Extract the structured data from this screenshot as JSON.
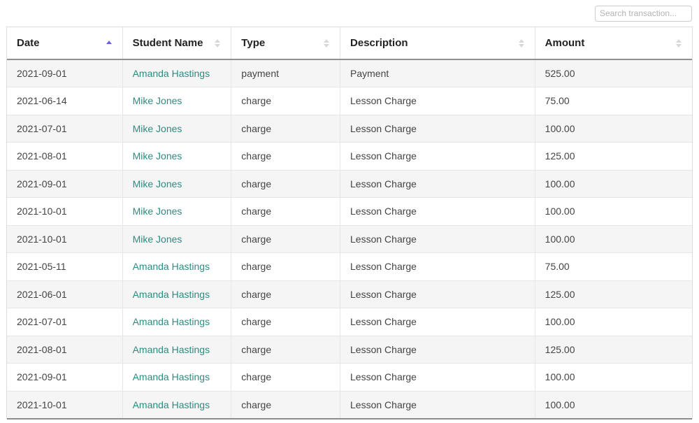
{
  "search": {
    "placeholder": "Search transaction...",
    "value": ""
  },
  "table": {
    "columns": [
      {
        "label": "Date",
        "sort": "asc",
        "key": "date"
      },
      {
        "label": "Student Name",
        "sort": "none",
        "key": "student_name"
      },
      {
        "label": "Type",
        "sort": "none",
        "key": "type"
      },
      {
        "label": "Description",
        "sort": "none",
        "key": "description"
      },
      {
        "label": "Amount",
        "sort": "none",
        "key": "amount"
      }
    ],
    "rows": [
      {
        "date": "2021-09-01",
        "student_name": "Amanda Hastings",
        "type": "payment",
        "description": "Payment",
        "amount": "525.00"
      },
      {
        "date": "2021-06-14",
        "student_name": "Mike Jones",
        "type": "charge",
        "description": "Lesson Charge",
        "amount": "75.00"
      },
      {
        "date": "2021-07-01",
        "student_name": "Mike Jones",
        "type": "charge",
        "description": "Lesson Charge",
        "amount": "100.00"
      },
      {
        "date": "2021-08-01",
        "student_name": "Mike Jones",
        "type": "charge",
        "description": "Lesson Charge",
        "amount": "125.00"
      },
      {
        "date": "2021-09-01",
        "student_name": "Mike Jones",
        "type": "charge",
        "description": "Lesson Charge",
        "amount": "100.00"
      },
      {
        "date": "2021-10-01",
        "student_name": "Mike Jones",
        "type": "charge",
        "description": "Lesson Charge",
        "amount": "100.00"
      },
      {
        "date": "2021-10-01",
        "student_name": "Mike Jones",
        "type": "charge",
        "description": "Lesson Charge",
        "amount": "100.00"
      },
      {
        "date": "2021-05-11",
        "student_name": "Amanda Hastings",
        "type": "charge",
        "description": "Lesson Charge",
        "amount": "75.00"
      },
      {
        "date": "2021-06-01",
        "student_name": "Amanda Hastings",
        "type": "charge",
        "description": "Lesson Charge",
        "amount": "125.00"
      },
      {
        "date": "2021-07-01",
        "student_name": "Amanda Hastings",
        "type": "charge",
        "description": "Lesson Charge",
        "amount": "100.00"
      },
      {
        "date": "2021-08-01",
        "student_name": "Amanda Hastings",
        "type": "charge",
        "description": "Lesson Charge",
        "amount": "125.00"
      },
      {
        "date": "2021-09-01",
        "student_name": "Amanda Hastings",
        "type": "charge",
        "description": "Lesson Charge",
        "amount": "100.00"
      },
      {
        "date": "2021-10-01",
        "student_name": "Amanda Hastings",
        "type": "charge",
        "description": "Lesson Charge",
        "amount": "100.00"
      }
    ]
  },
  "colors": {
    "link": "#2e8b80",
    "sort_active": "#6a61e0",
    "sort_inactive": "#d8d8d8",
    "row_stripe": "#f5f5f5",
    "border": "#e6e6e6",
    "header_text": "#222222",
    "body_text": "#444444"
  }
}
